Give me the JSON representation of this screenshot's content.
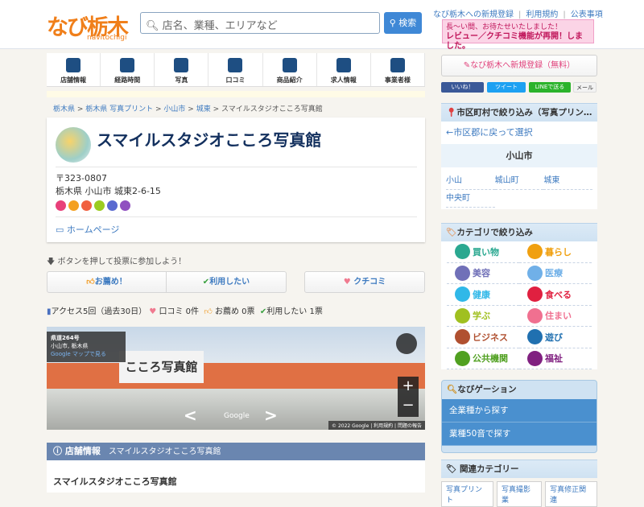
{
  "header": {
    "logo": "なび栃木",
    "logo_sub": "navitochigi",
    "search_placeholder": "店名、業種、エリアなど",
    "search_button": "検索",
    "links": [
      "なび栃木への新規登録",
      "利用規約",
      "公表事項"
    ],
    "banner_line1": "長〜い間、お待たせいたしました！",
    "banner_line2": "レビュー／クチコミ機能が再開！しました。"
  },
  "nav": [
    "店舗情報",
    "経路時間",
    "写真",
    "口コミ",
    "商品紹介",
    "求人情報",
    "事業者様"
  ],
  "breadcrumb": [
    "栃木県",
    "栃木県 写真プリント",
    "小山市",
    "城東",
    "スマイルスタジオこころ写真館"
  ],
  "shop": {
    "name": "スマイルスタジオこころ写真館",
    "postal": "〒323-0807",
    "address": "栃木県 小山市 城東2-6-15",
    "homepage": "ホームページ",
    "icon_colors": [
      "#e8407a",
      "#f4a020",
      "#f06040",
      "#9ccc20",
      "#5a6ad0",
      "#9050c0"
    ]
  },
  "vote": {
    "hint": "ボタンを押して投票に参加しよう！",
    "recommend": "お薦め！",
    "want": "利用したい",
    "review": "クチコミ"
  },
  "stats": {
    "access": "アクセス5回（過去30日）",
    "reviews": "口コミ 0件",
    "recommend": "お薦め 0票",
    "want": "利用したい 1票"
  },
  "streetview": {
    "road": "県道264号",
    "place": "小山市, 栃木県",
    "maplink": "Google マップで見る",
    "sign": "こころ写真館",
    "google": "Google",
    "copyright": "© 2022 Google",
    "terms": "利用規約",
    "report": "問題の報告"
  },
  "info": {
    "heading": "店舗情報",
    "subtitle": "スマイルスタジオこころ写真館",
    "name": "スマイルスタジオこころ写真館"
  },
  "sidebar": {
    "register": "なび栃木へ新規登録（無料）",
    "share": [
      "いいね！",
      "ツイート",
      "LINEで送る",
      "メール"
    ],
    "area_title": "市区町村で絞り込み（写真プリン…",
    "back": "←市区郡に戻って選択",
    "city": "小山市",
    "towns": [
      "小山",
      "城山町",
      "城東",
      "中央町"
    ],
    "cat_title": "カテゴリで絞り込み",
    "categories": [
      {
        "label": "買い物",
        "color": "#2aa890"
      },
      {
        "label": "暮らし",
        "color": "#f0a010"
      },
      {
        "label": "美容",
        "color": "#7070b8"
      },
      {
        "label": "医療",
        "color": "#70b0e8"
      },
      {
        "label": "健康",
        "color": "#30b8e8"
      },
      {
        "label": "食べる",
        "color": "#e02040"
      },
      {
        "label": "学ぶ",
        "color": "#a0c020"
      },
      {
        "label": "住まい",
        "color": "#f07090"
      },
      {
        "label": "ビジネス",
        "color": "#b05030"
      },
      {
        "label": "遊び",
        "color": "#2070b0"
      },
      {
        "label": "公共機関",
        "color": "#50a020"
      },
      {
        "label": "福祉",
        "color": "#802080"
      }
    ],
    "navi_title": "なびゲーション",
    "navi_items": [
      "全業種から探す",
      "業種50音で探す"
    ],
    "related_title": "関連カテゴリー",
    "related": [
      "写真プリント",
      "写真撮影業",
      "写真修正関連"
    ]
  }
}
